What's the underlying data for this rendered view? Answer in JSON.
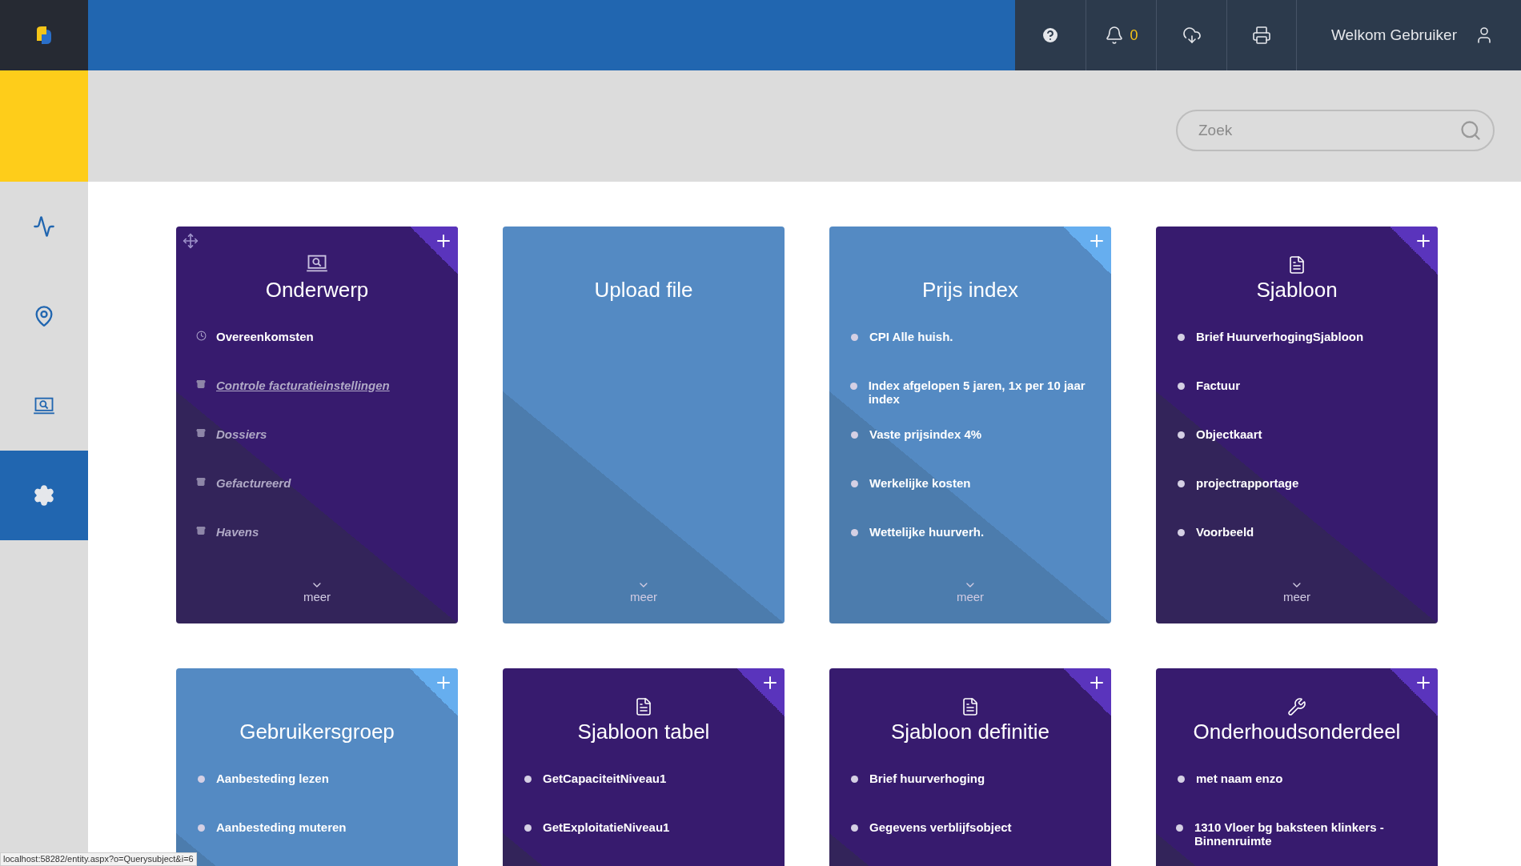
{
  "topbar": {
    "notification_count": "0",
    "welcome": "Welkom Gebruiker"
  },
  "sidebar": {
    "items": [
      {
        "kind": "activity",
        "selected": false
      },
      {
        "kind": "location",
        "selected": false
      },
      {
        "kind": "laptop-search",
        "selected": false
      },
      {
        "kind": "settings",
        "selected": true
      }
    ]
  },
  "search": {
    "placeholder": "Zoek"
  },
  "cards": [
    {
      "title": "Onderwerp",
      "color": "#371b6e",
      "kind": "laptop",
      "movable": true,
      "addable": true,
      "more": "meer",
      "items": [
        {
          "label": "Overeenkomsten",
          "kind": "clock",
          "muted": false,
          "underlined": false
        },
        {
          "label": "Controle facturatieinstellingen",
          "kind": "archive",
          "muted": true,
          "underlined": true
        },
        {
          "label": "Dossiers",
          "kind": "archive",
          "muted": true,
          "underlined": false
        },
        {
          "label": "Gefactureerd",
          "kind": "archive",
          "muted": true,
          "underlined": false
        },
        {
          "label": "Havens",
          "kind": "archive",
          "muted": true,
          "underlined": false
        }
      ]
    },
    {
      "title": "Upload file",
      "color": "#548ac3",
      "kind": "plain",
      "movable": false,
      "addable": false,
      "more": "meer"
    },
    {
      "title": "Prijs index",
      "color": "#548ac3",
      "kind": "plain",
      "movable": false,
      "addable": true,
      "more": "meer",
      "items": [
        {
          "label": "CPI Alle huish.",
          "kind": "bullet",
          "muted": false,
          "underlined": false
        },
        {
          "label": "Index afgelopen 5 jaren, 1x per 10 jaar index",
          "kind": "bullet",
          "muted": false,
          "underlined": false
        },
        {
          "label": "Vaste prijsindex 4%",
          "kind": "bullet",
          "muted": false,
          "underlined": false
        },
        {
          "label": "Werkelijke kosten",
          "kind": "bullet",
          "muted": false,
          "underlined": false
        },
        {
          "label": "Wettelijke huurverh.",
          "kind": "bullet",
          "muted": false,
          "underlined": false
        }
      ]
    },
    {
      "title": "Sjabloon",
      "color": "#371b6e",
      "kind": "document",
      "movable": false,
      "addable": true,
      "more": "meer",
      "items": [
        {
          "label": "Brief HuurverhogingSjabloon",
          "kind": "bullet",
          "muted": false,
          "underlined": false
        },
        {
          "label": "Factuur",
          "kind": "bullet",
          "muted": false,
          "underlined": false
        },
        {
          "label": "Objectkaart",
          "kind": "bullet",
          "muted": false,
          "underlined": false
        },
        {
          "label": "projectrapportage",
          "kind": "bullet",
          "muted": false,
          "underlined": false
        },
        {
          "label": "Voorbeeld",
          "kind": "bullet",
          "muted": false,
          "underlined": false
        }
      ]
    },
    {
      "title": "Gebruikersgroep",
      "color": "#548ac3",
      "kind": "plain",
      "movable": false,
      "addable": true,
      "items": [
        {
          "label": "Aanbesteding lezen",
          "kind": "bullet",
          "muted": false,
          "underlined": false
        },
        {
          "label": "Aanbesteding muteren",
          "kind": "bullet",
          "muted": false,
          "underlined": false
        }
      ]
    },
    {
      "title": "Sjabloon tabel",
      "color": "#371b6e",
      "kind": "document",
      "movable": false,
      "addable": true,
      "items": [
        {
          "label": "GetCapaciteitNiveau1",
          "kind": "bullet",
          "muted": false,
          "underlined": false
        },
        {
          "label": "GetExploitatieNiveau1",
          "kind": "bullet",
          "muted": false,
          "underlined": false
        }
      ]
    },
    {
      "title": "Sjabloon definitie",
      "color": "#371b6e",
      "kind": "document",
      "movable": false,
      "addable": true,
      "items": [
        {
          "label": "Brief huurverhoging",
          "kind": "bullet",
          "muted": false,
          "underlined": false
        },
        {
          "label": "Gegevens verblijfsobject",
          "kind": "bullet",
          "muted": false,
          "underlined": false
        }
      ]
    },
    {
      "title": "Onderhoudsonderdeel",
      "color": "#371b6e",
      "kind": "tools",
      "movable": false,
      "addable": true,
      "items": [
        {
          "label": "met naam enzo",
          "kind": "bullet",
          "muted": false,
          "underlined": false
        },
        {
          "label": "1310 Vloer bg baksteen klinkers - Binnenruimte",
          "kind": "bullet",
          "muted": false,
          "underlined": false
        }
      ]
    }
  ],
  "status_url": "localhost:58282/entity.aspx?o=Querysubject&i=6"
}
